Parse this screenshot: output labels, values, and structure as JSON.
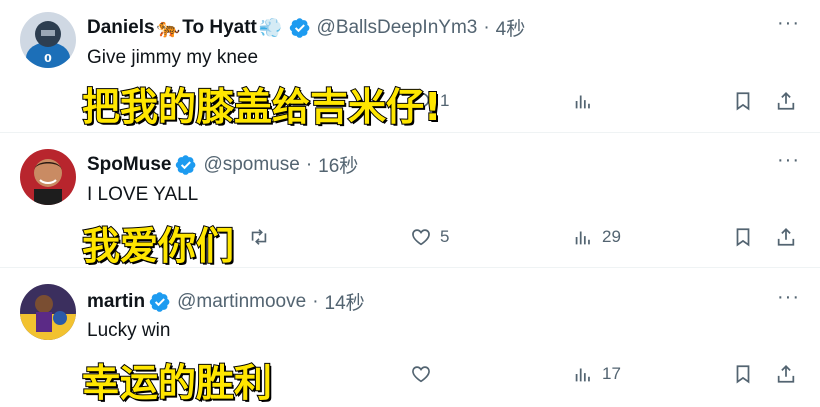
{
  "tweets": [
    {
      "name": "Daniels",
      "name_suffix": "To Hyatt",
      "emoji1": "🐅",
      "emoji2": "💨",
      "handle": "@BallsDeepInYm3",
      "time": "4秒",
      "text": "Give jimmy my knee",
      "overlay": "把我的膝盖给吉米仔!",
      "reply_count": "1"
    },
    {
      "name": "SpoMuse",
      "handle": "@spomuse",
      "time": "16秒",
      "text": "I LOVE YALL",
      "overlay": "我爱你们",
      "like_count": "5",
      "view_count": "29"
    },
    {
      "name": "martin",
      "handle": "@martinmoove",
      "time": "14秒",
      "text": "Lucky win",
      "overlay": "幸运的胜利",
      "view_count": "17"
    }
  ],
  "separator": "·",
  "more_glyph": "···",
  "colors": {
    "verified": "#1d9bf0",
    "muted": "#536471",
    "overlay_fill": "#ffe600"
  },
  "icons": [
    "verified-badge-icon",
    "more-icon",
    "reply-icon",
    "retweet-icon",
    "like-icon",
    "views-icon",
    "bookmark-icon",
    "share-icon"
  ]
}
